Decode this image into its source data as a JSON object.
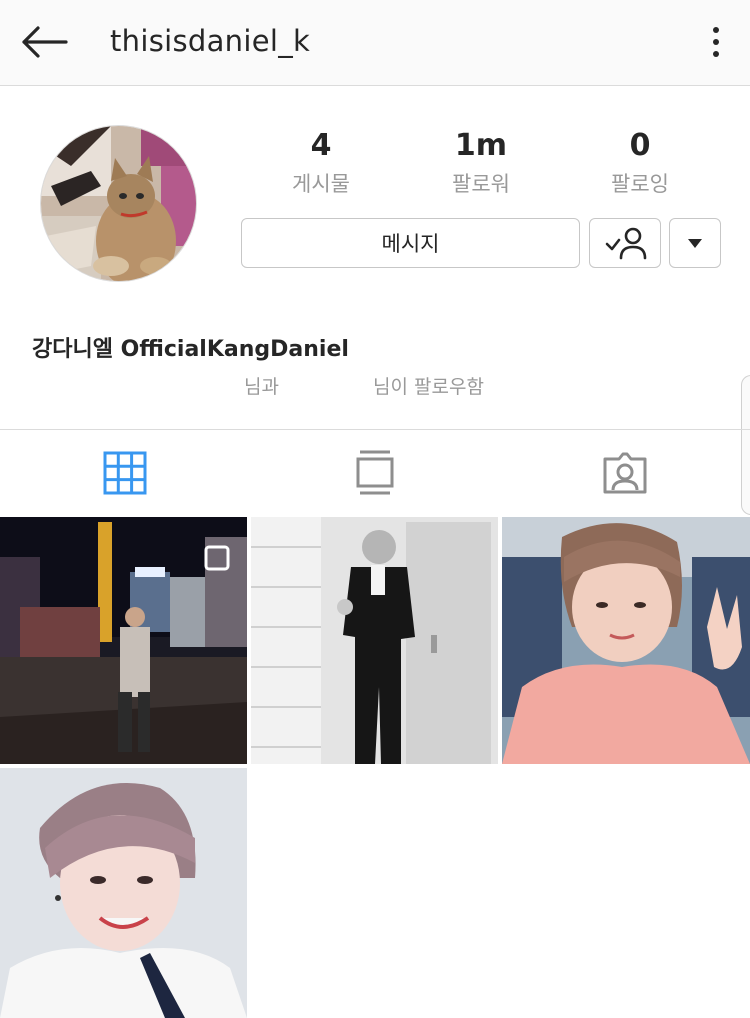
{
  "header": {
    "username": "thisisdaniel_k",
    "back_icon": "arrow-left-icon",
    "more_icon": "more-vertical-icon"
  },
  "profile": {
    "avatar": "profile-avatar-cat-photo",
    "stats": [
      {
        "value": "4",
        "label": "게시물"
      },
      {
        "value": "1m",
        "label": "팔로워"
      },
      {
        "value": "0",
        "label": "팔로잉"
      }
    ],
    "message_label": "메시지",
    "following_icon": "person-check-icon",
    "dropdown_icon": "caret-down-icon",
    "full_name": "강다니엘 OfficialKangDaniel",
    "mutual_prefix": "님과",
    "mutual_suffix": "님이 팔로우함"
  },
  "tabs": [
    {
      "name": "grid",
      "icon": "grid-icon",
      "active": true
    },
    {
      "name": "feed",
      "icon": "feed-icon",
      "active": false
    },
    {
      "name": "tagged",
      "icon": "tagged-person-icon",
      "active": false
    }
  ],
  "posts": [
    {
      "name": "post-night-city-street",
      "multi_icon": "multiple-photos-icon"
    },
    {
      "name": "post-black-white-suit"
    },
    {
      "name": "post-pink-hoodie-selfie"
    },
    {
      "name": "post-white-shirt-portrait"
    }
  ],
  "colors": {
    "accent_active_tab": "#3897f0",
    "muted_text": "#999999",
    "border": "#dbdbdb"
  }
}
